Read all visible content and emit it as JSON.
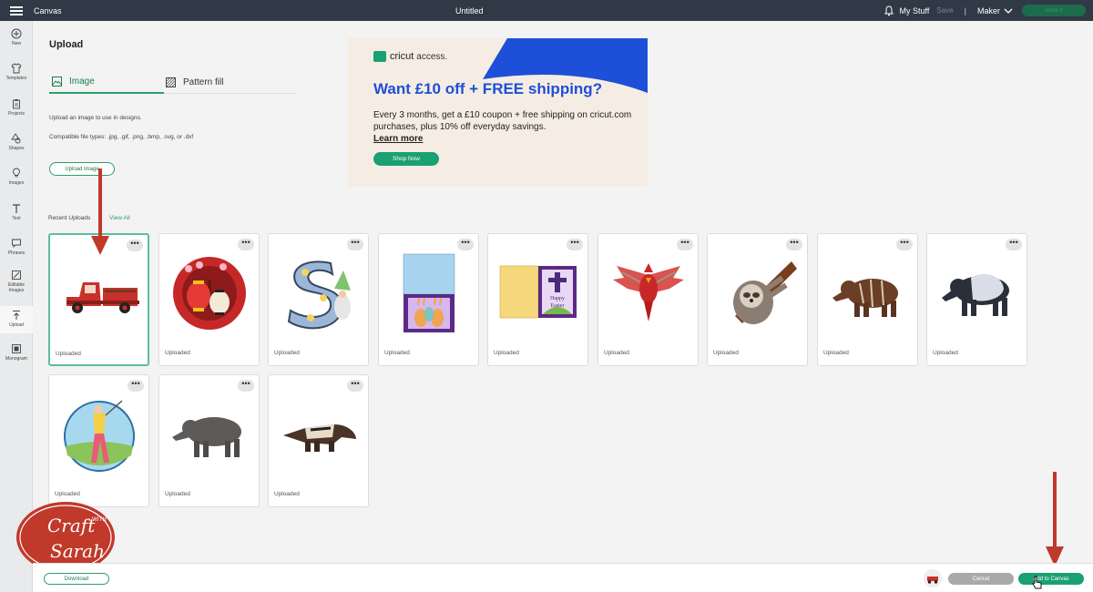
{
  "topbar": {
    "app_title": "Canvas",
    "doc_title": "Untitled",
    "my_stuff": "My Stuff",
    "save": "Save",
    "separator": "|",
    "machine": "Maker",
    "make_it": "Make It"
  },
  "sidebar": {
    "items": [
      {
        "label": "New",
        "icon": "plus-circle-icon"
      },
      {
        "label": "Templates",
        "icon": "shirt-icon"
      },
      {
        "label": "Projects",
        "icon": "clipboard-icon"
      },
      {
        "label": "Shapes",
        "icon": "shapes-icon"
      },
      {
        "label": "Images",
        "icon": "lightbulb-icon"
      },
      {
        "label": "Text",
        "icon": "text-icon"
      },
      {
        "label": "Phrases",
        "icon": "speech-bubble-icon"
      },
      {
        "label": "Editable Images",
        "icon": "editable-image-icon"
      },
      {
        "label": "Upload",
        "icon": "upload-icon"
      },
      {
        "label": "Monogram",
        "icon": "monogram-icon"
      }
    ],
    "active": "Upload"
  },
  "panel": {
    "title": "Upload",
    "tabs": [
      {
        "label": "Image",
        "icon": "image-icon"
      },
      {
        "label": "Pattern fill",
        "icon": "pattern-icon"
      }
    ],
    "description": "Upload an image to use in designs.",
    "file_types": "Compatible file types: .jpg, .gif, .png, .bmp, .svg, or .dxf",
    "upload_button": "Upload Image",
    "recent_label": "Recent Uploads",
    "view_all": "View All"
  },
  "ad": {
    "brand": "cricut",
    "brand_suffix": "access.",
    "headline": "Want £10 off + FREE shipping?",
    "body": "Every 3 months, get a £10 coupon + free shipping on cricut.com purchases, plus 10% off everyday savings.",
    "learn_more": "Learn more",
    "shop_now": "Shop Now",
    "colors": {
      "blue": "#1e4fd8",
      "green": "#1aa073",
      "cream": "#f5ede4"
    }
  },
  "uploads": [
    {
      "label": "Uploaded",
      "icon": "red-truck-image",
      "selected": true
    },
    {
      "label": "Uploaded",
      "icon": "chinese-lantern-image"
    },
    {
      "label": "Uploaded",
      "icon": "letter-s-gnome-image"
    },
    {
      "label": "Uploaded",
      "icon": "easter-bunny-card-image"
    },
    {
      "label": "Uploaded",
      "icon": "happy-easter-card-image",
      "text": "Happy Easter"
    },
    {
      "label": "Uploaded",
      "icon": "cardinal-bird-image"
    },
    {
      "label": "Uploaded",
      "icon": "sloth-image"
    },
    {
      "label": "Uploaded",
      "icon": "baby-tapir-image"
    },
    {
      "label": "Uploaded",
      "icon": "malayan-tapir-image"
    },
    {
      "label": "Uploaded",
      "icon": "golfer-image"
    },
    {
      "label": "Uploaded",
      "icon": "tapir-image"
    },
    {
      "label": "Uploaded",
      "icon": "anteater-image"
    }
  ],
  "more_glyph": "•••",
  "bottombar": {
    "download": "Download",
    "cancel": "Cancel",
    "add_to_canvas": "Add to Canvas"
  },
  "watermark": {
    "line1": "Craft",
    "with": "WITH",
    "line2": "Sarah",
    "color": "#c0392b"
  }
}
